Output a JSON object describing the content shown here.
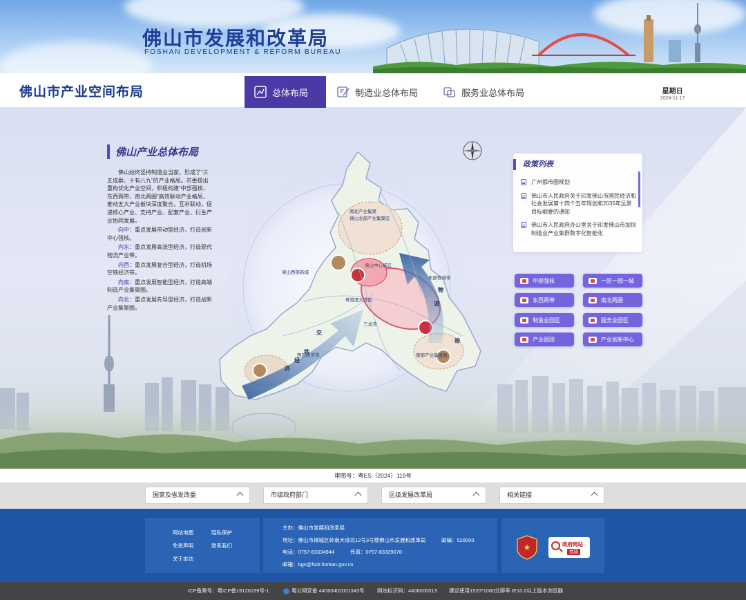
{
  "banner": {
    "title": "佛山市发展和改革局",
    "subtitle": "FOSHAN DEVELOPMENT & REFORM BUREAU"
  },
  "nav": {
    "page_title": "佛山市产业空间布局",
    "tabs": [
      {
        "label": "总体布局",
        "icon": "chart-icon",
        "active": true
      },
      {
        "label": "制造业总体布局",
        "icon": "edit-icon",
        "active": false
      },
      {
        "label": "服务业总体布局",
        "icon": "service-icon",
        "active": false
      }
    ],
    "weekday": "星期日",
    "date": "2024-11-17"
  },
  "intro": {
    "title": "佛山产业总体布局",
    "paragraph": "佛山始终坚持制造业当家，形成了“三五成群、十有八九”的产业格局。市委提出重构优化产业空间，积极构建“中部强核、东西两带、南北两圈”高效联动产业格局，推动五大产业板块深度聚合，互补联动，促进核心产业、支持产业、配套产业、衍生产业协同发展。",
    "items": [
      {
        "dir": "向中：",
        "text": "重点发展带动型经济，打造创新中心强核。"
      },
      {
        "dir": "向东：",
        "text": "重点发展高流型经济，打造现代物流产业带。"
      },
      {
        "dir": "向西：",
        "text": "重点发展复合型经济，打造机场空铁经济带。"
      },
      {
        "dir": "向南：",
        "text": "重点发展智能型经济，打造高端制造产业集聚圈。"
      },
      {
        "dir": "向北：",
        "text": "重点发展先导型经济，打造战新产业集聚圈。"
      }
    ]
  },
  "policy": {
    "title": "政策列表",
    "items": [
      "广州都市圈规划",
      "佛山市人民政府关于印发佛山市国民经济和社会发展第十四个五年规划和2035年远景目标纲要的通知",
      "佛山市人民政府办公室关于印发佛山市加快制造业产业集群数字化智能化"
    ]
  },
  "categories": [
    {
      "label": "中部强核"
    },
    {
      "label": "一区一园一城"
    },
    {
      "label": "东西两带"
    },
    {
      "label": "南北两圈"
    },
    {
      "label": "制造业园区"
    },
    {
      "label": "服务业园区"
    },
    {
      "label": "产业园团"
    },
    {
      "label": "产业创新中心"
    }
  ],
  "map": {
    "labels": [
      "南北产业集聚",
      "佛山北部产业集聚区",
      "佛山西部新城",
      "佛山中心城区",
      "南部产业集聚圈",
      "西部经济带",
      "东部物流带",
      "粤港澳大湾区",
      "三龙湾",
      "铁",
      "经",
      "济",
      "带",
      "物",
      "流",
      "交"
    ]
  },
  "approval_no": "审图号：粤ES（2024）119号",
  "links": [
    {
      "label": "国家及省发改委"
    },
    {
      "label": "市级政府部门"
    },
    {
      "label": "区级发展改革局"
    },
    {
      "label": "相关链接"
    }
  ],
  "footer": {
    "links": [
      "网站地图",
      "隐私保护",
      "免责声明",
      "联系我们",
      "关于本站"
    ],
    "host": "主办：佛山市发展和改革局",
    "address": "地址：佛山市禅城区岭南大道北12号3号楼佛山市发展和改革局",
    "postcode": "邮编：528000",
    "phone": "电话：0757-83334944",
    "fax": "传真：0757-83329070",
    "email": "邮箱：bgs@fsdr.foshan.gov.cn",
    "gov_err_title": "政府网站",
    "gov_err_sub": "找错"
  },
  "bottom": {
    "icp": "ICP备案号：粤ICP备19126199号-1",
    "police": "粤公网安备 44060402001343号",
    "site_code": "网站标识码：4406000013",
    "suggestion": "建议使用1920*1080分辨率 IE10.0以上版本浏览器"
  },
  "colors": {
    "primary": "#4a3aa8",
    "button": "#7564dd",
    "footer": "#1f55a4",
    "title_blue": "#1e3f96"
  }
}
